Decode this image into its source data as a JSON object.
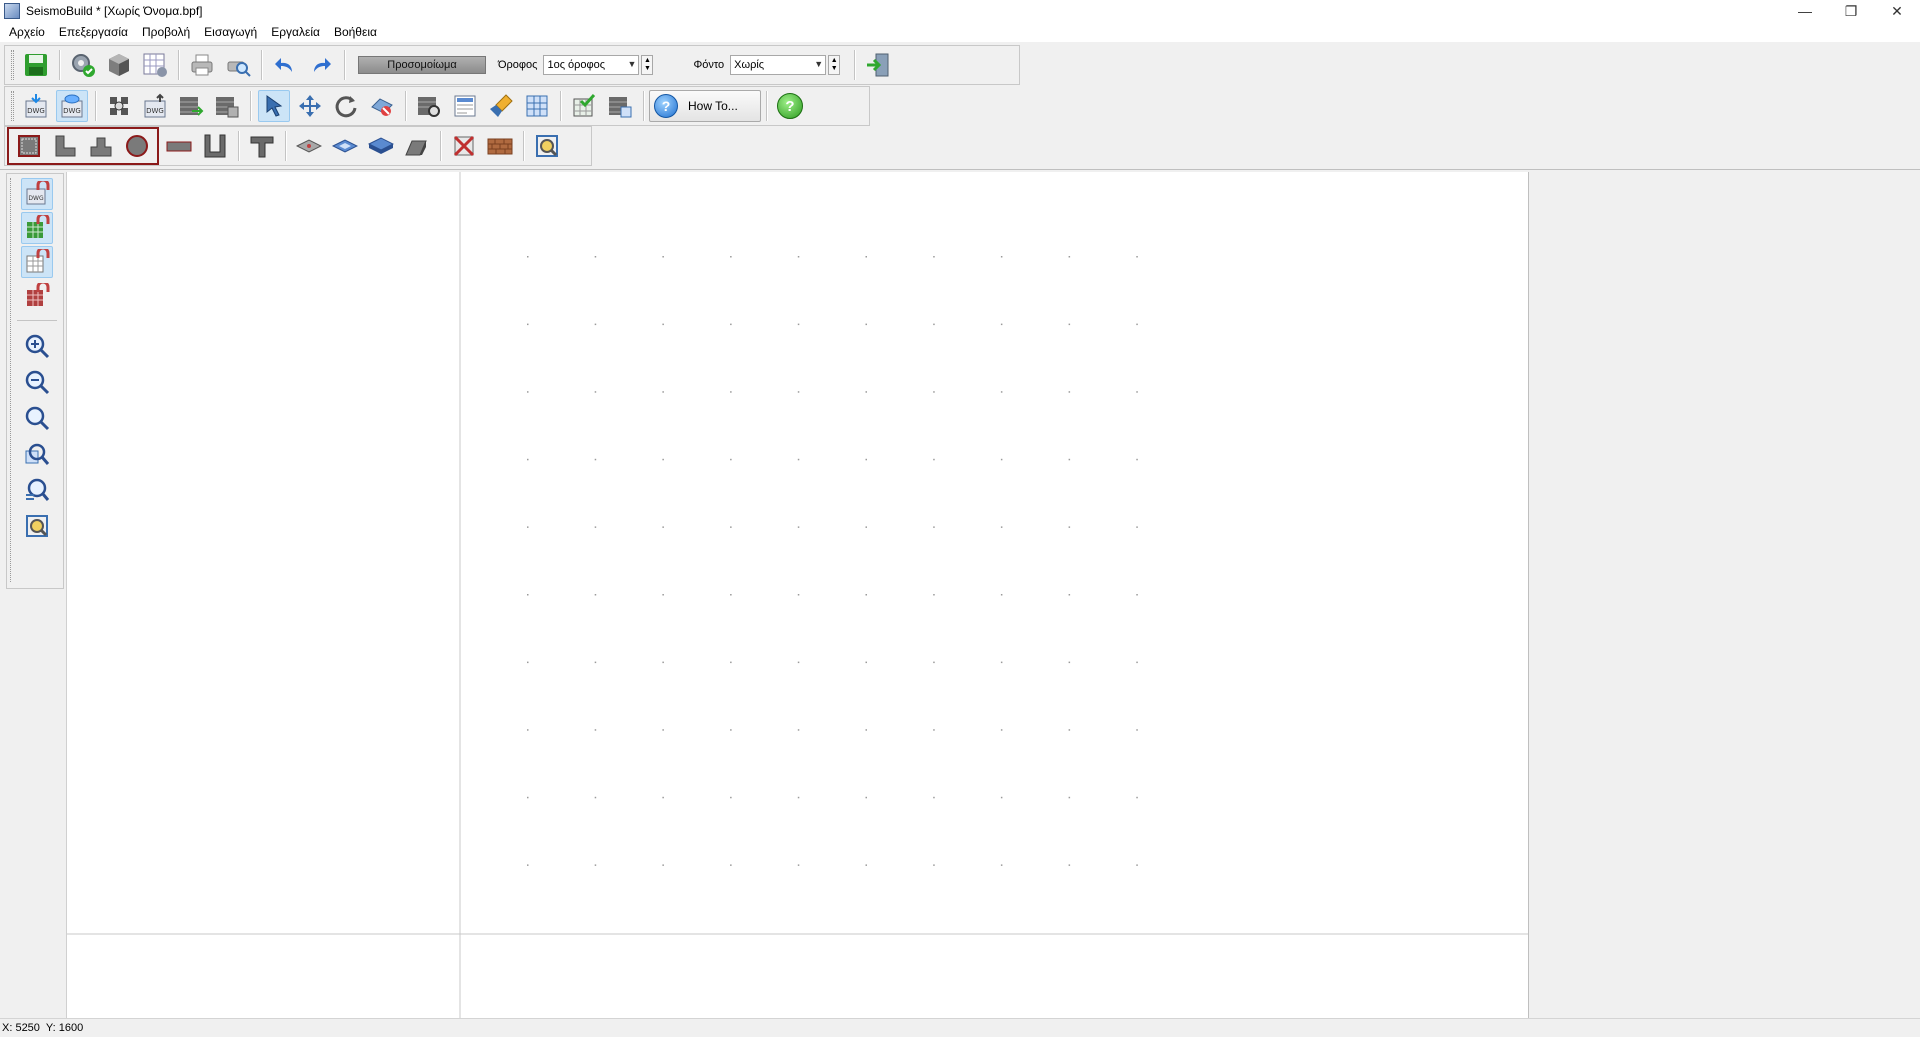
{
  "window": {
    "title": "SeismoBuild * [Χωρίς Όνομα.bpf]",
    "controls": [
      "—",
      "❐",
      "✕"
    ]
  },
  "menu": [
    "Αρχείο",
    "Επεξεργασία",
    "Προβολή",
    "Εισαγωγή",
    "Εργαλεία",
    "Βοήθεια"
  ],
  "toolbar": {
    "simulation_label": "Προσομοίωμα",
    "floor_label": "Όροφος",
    "floor_value": "1ος όροφος",
    "background_label": "Φόντο",
    "background_value": "Χωρίς",
    "howto_label": "How To...",
    "help_glyph": "?"
  },
  "status": {
    "x_label": "X: 5250",
    "y_label": "Y: 1600"
  },
  "colors": {
    "selection_border": "#8b1a1a",
    "active_tool": "#cce4f7",
    "canvas": "#ffffff",
    "grid_dot": "#9a9a9a"
  },
  "icons": {
    "save": "save-icon",
    "settings": "gear-check-icon",
    "model3d": "cube-icon",
    "grid": "grid-settings-icon",
    "print": "printer-icon",
    "print_preview": "print-preview-icon",
    "undo": "undo-icon",
    "redo": "redo-icon",
    "exit": "exit-door-icon"
  }
}
